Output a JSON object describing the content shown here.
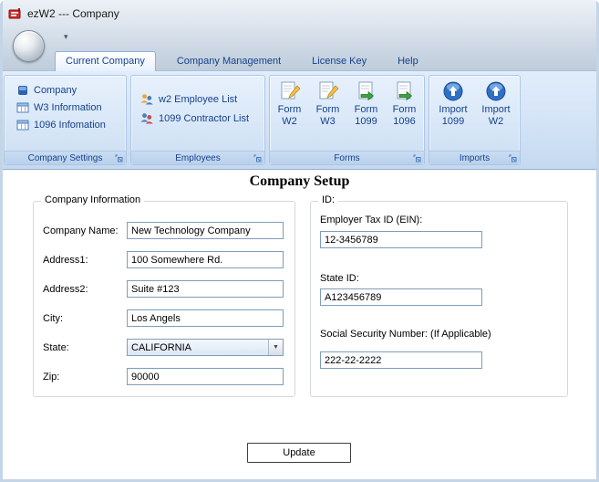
{
  "window": {
    "title": "ezW2 --- Company"
  },
  "icons": {
    "qat_dropdown": "▾",
    "combo_arrow": "▼"
  },
  "colors": {
    "ribbon_text": "#15428b",
    "ribbon_bg": "#d3e3f6",
    "input_border": "#7f9db9",
    "app_icon_red": "#d22b2b"
  },
  "ribbon": {
    "tabs": [
      {
        "label": "Current Company"
      },
      {
        "label": "Company Management"
      },
      {
        "label": "License Key"
      },
      {
        "label": "Help"
      }
    ],
    "groups": {
      "company_settings": {
        "title": "Company Settings",
        "items": [
          {
            "label": "Company"
          },
          {
            "label": "W3 Information"
          },
          {
            "label": "1096 Infomation"
          }
        ]
      },
      "employees": {
        "title": "Employees",
        "items": [
          {
            "label": "w2 Employee List"
          },
          {
            "label": "1099 Contractor List"
          }
        ]
      },
      "forms": {
        "title": "Forms",
        "items": [
          {
            "line1": "Form",
            "line2": "W2"
          },
          {
            "line1": "Form",
            "line2": "W3"
          },
          {
            "line1": "Form",
            "line2": "1099"
          },
          {
            "line1": "Form",
            "line2": "1096"
          }
        ]
      },
      "imports": {
        "title": "Imports",
        "items": [
          {
            "line1": "Import",
            "line2": "1099"
          },
          {
            "line1": "Import",
            "line2": "W2"
          }
        ]
      }
    }
  },
  "main": {
    "heading": "Company Setup",
    "company_info": {
      "title": "Company Information",
      "fields": [
        {
          "label": "Company Name:",
          "value": "New Technology Company"
        },
        {
          "label": "Address1:",
          "value": "100 Somewhere Rd."
        },
        {
          "label": "Address2:",
          "value": "Suite #123"
        },
        {
          "label": "City:",
          "value": "Los Angels"
        },
        {
          "label": "State:",
          "value": "CALIFORNIA"
        },
        {
          "label": "Zip:",
          "value": "90000"
        }
      ]
    },
    "ids": {
      "title": "ID:",
      "ein_label": "Employer Tax ID (EIN):",
      "ein_value": "12-3456789",
      "state_id_label": "State ID:",
      "state_id_value": "A123456789",
      "ssn_label": "Social Security Number: (If Applicable)",
      "ssn_value": "222-22-2222"
    },
    "update_label": "Update"
  }
}
